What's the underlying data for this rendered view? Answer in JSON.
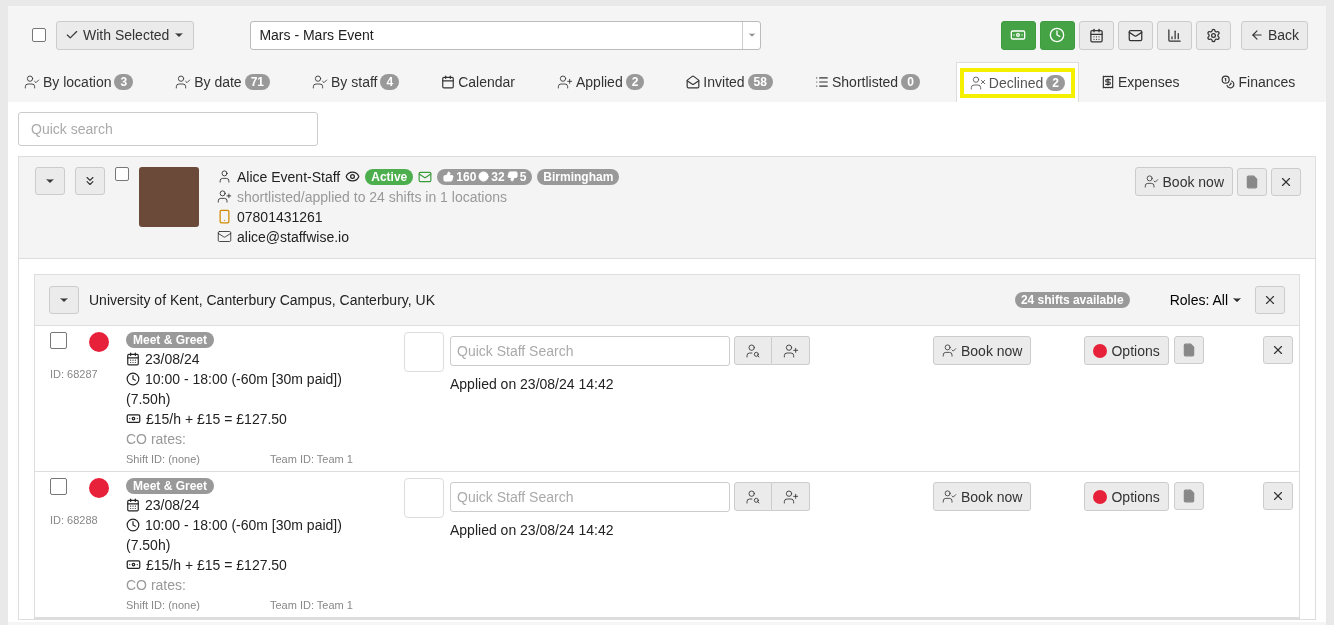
{
  "toolbar": {
    "select_all_checked": false,
    "with_selected": "With Selected",
    "event": "Mars - Mars Event",
    "back": "Back",
    "icon_buttons": [
      {
        "kind": "money",
        "active": true
      },
      {
        "kind": "clock",
        "active": true
      },
      {
        "kind": "calendar",
        "active": false
      },
      {
        "kind": "mail",
        "active": false
      },
      {
        "kind": "chart",
        "active": false
      },
      {
        "kind": "settings",
        "active": false
      }
    ]
  },
  "tabs": [
    {
      "kind": "usercheck",
      "label": "By location",
      "count": "3",
      "selected": false
    },
    {
      "kind": "usercheck",
      "label": "By date",
      "count": "71",
      "selected": false
    },
    {
      "kind": "usercheck",
      "label": "By staff",
      "count": "4",
      "selected": false
    },
    {
      "kind": "calendar",
      "label": "Calendar",
      "selected": false
    },
    {
      "kind": "userplus",
      "label": "Applied",
      "count": "2",
      "selected": false
    },
    {
      "kind": "mail",
      "label": "Invited",
      "count": "58",
      "selected": false
    },
    {
      "kind": "list",
      "label": "Shortlisted",
      "count": "0",
      "selected": false
    },
    {
      "kind": "userx",
      "label": "Declined",
      "count": "2",
      "selected": true
    },
    {
      "kind": "receipt",
      "label": "Expenses",
      "selected": false
    },
    {
      "kind": "coins",
      "label": "Finances",
      "selected": false
    }
  ],
  "search": {
    "placeholder": "Quick search"
  },
  "staff": {
    "checked": false,
    "name": "Alice Event-Staff",
    "status": "Active",
    "likes": "160",
    "neutral": "32",
    "dislikes": "5",
    "city": "Birmingham",
    "summary": "shortlisted/applied to 24 shifts in 1 locations",
    "phone": "07801431261",
    "email": "alice@staffwise.io",
    "book": "Book now"
  },
  "location": {
    "name": "University of Kent, Canterbury Campus, Canterbury, UK",
    "available": "24 shifts available",
    "roles": "Roles: All",
    "shifts": [
      {
        "checked": false,
        "color": "#e8213a",
        "id": "ID: 68287",
        "role": "Meet & Greet",
        "date": "23/08/24",
        "time": "10:00 - 18:00 (-60m [30m paid])",
        "hours": "(7.50h)",
        "pay": "£15/h + £15 = £127.50",
        "co_rates": "CO rates:",
        "shift_id": "Shift ID: (none)",
        "team_id": "Team ID: Team 1",
        "placeholder": "Quick Staff Search",
        "applied": "Applied on 23/08/24 14:42",
        "book": "Book now",
        "options": "Options"
      },
      {
        "checked": false,
        "color": "#e8213a",
        "id": "ID: 68288",
        "role": "Meet & Greet",
        "date": "23/08/24",
        "time": "10:00 - 18:00 (-60m [30m paid])",
        "hours": "(7.50h)",
        "pay": "£15/h + £15 = £127.50",
        "co_rates": "CO rates:",
        "shift_id": "Shift ID: (none)",
        "team_id": "Team ID: Team 1",
        "placeholder": "Quick Staff Search",
        "applied": "Applied on 23/08/24 14:42",
        "book": "Book now",
        "options": "Options"
      }
    ]
  }
}
